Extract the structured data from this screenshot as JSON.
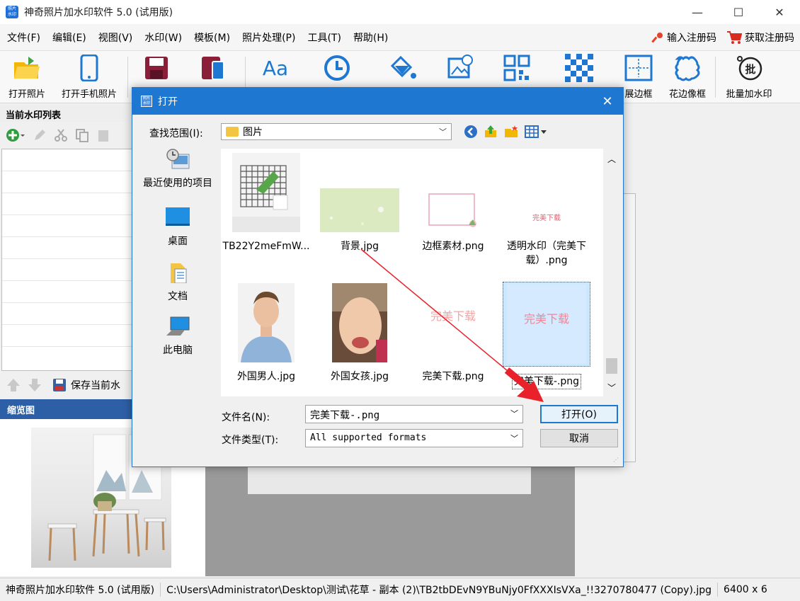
{
  "window": {
    "title": "神奇照片加水印软件 5.0 (试用版)",
    "minimize": "—",
    "maximize": "☐",
    "close": "✕"
  },
  "menu": {
    "items": [
      "文件(F)",
      "编辑(E)",
      "视图(V)",
      "水印(W)",
      "模板(M)",
      "照片处理(P)",
      "工具(T)",
      "帮助(H)"
    ],
    "register": "输入注册码",
    "get_code": "获取注册码"
  },
  "toolbar": {
    "open_photo": "打开照片",
    "open_phone_photo": "打开手机照片",
    "expand_border": "展边框",
    "lace_frame": "花边像框",
    "batch_watermark": "批量加水印",
    "text_icon_glyph": "Aa"
  },
  "left_panel": {
    "list_title": "当前水印列表",
    "save_current": "保存当前水",
    "thumb_title": "缩览图"
  },
  "status": {
    "app": "神奇照片加水印软件 5.0 (试用版)",
    "path": "C:\\Users\\Administrator\\Desktop\\测试\\花草 - 副本 (2)\\TB2tbDEvN9YBuNjy0FfXXXIsVXa_!!3270780477 (Copy).jpg",
    "dims": "6400 x 6"
  },
  "dialog": {
    "title": "打开",
    "icon_text": "照片 水印",
    "look_in_label": "查找范围(I):",
    "look_in_value": "图片",
    "places": [
      {
        "label": "最近使用的项目",
        "icon": "recent-icon"
      },
      {
        "label": "桌面",
        "icon": "desktop-icon"
      },
      {
        "label": "文档",
        "icon": "documents-icon"
      },
      {
        "label": "此电脑",
        "icon": "computer-icon"
      }
    ],
    "files": [
      {
        "name": "TB22Y2meFmW...",
        "thumb": "grid-plant"
      },
      {
        "name": "背景.jpg",
        "thumb": "green-bg"
      },
      {
        "name": "边框素材.png",
        "thumb": "pink-frame"
      },
      {
        "name": "透明水印（完美下载）.png",
        "thumb": "transparent-wm",
        "text": "完美下载"
      },
      {
        "name": "外国男人.jpg",
        "thumb": "man-portrait"
      },
      {
        "name": "外国女孩.jpg",
        "thumb": "girl-portrait"
      },
      {
        "name": "完美下载.png",
        "thumb": "wm",
        "text": "完美下载"
      },
      {
        "name": "完美下载-.png",
        "thumb": "wm-selected",
        "text": "完美下载",
        "selected": true
      }
    ],
    "file_name_label": "文件名(N):",
    "file_name_value": "完美下载-.png",
    "file_type_label": "文件类型(T):",
    "file_type_value": "All supported formats",
    "open_button": "打开(O)",
    "cancel_button": "取消"
  },
  "colors": {
    "accent": "#1e78d2",
    "annotation": "#e8212a",
    "thumb_header": "#2d5fa6"
  }
}
